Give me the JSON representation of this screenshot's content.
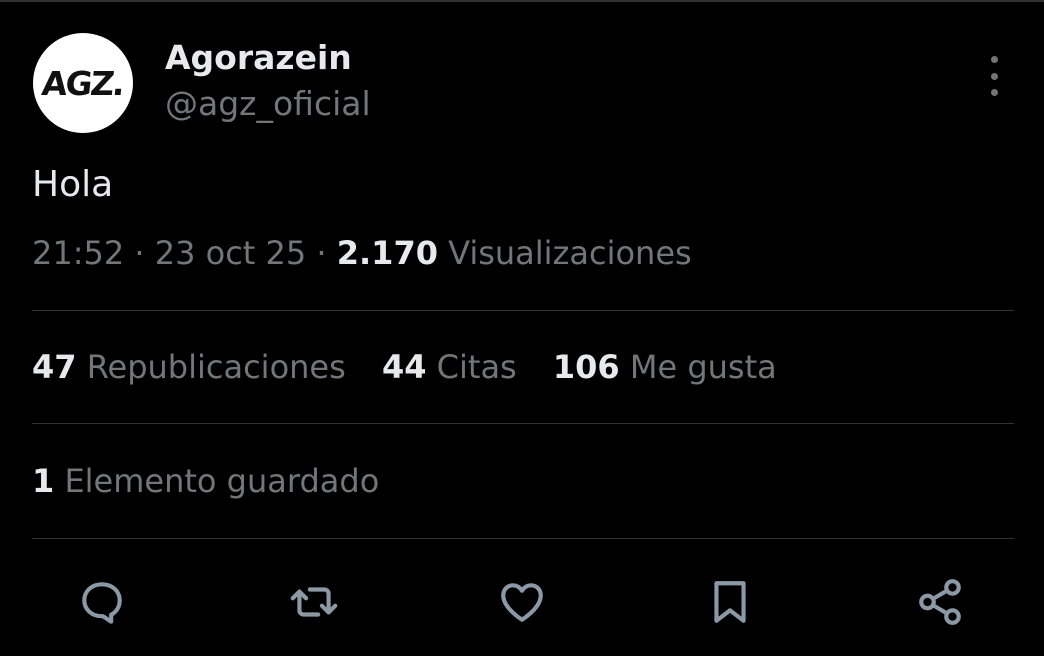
{
  "colors": {
    "background": "#000000",
    "primary_text": "#e7e9ea",
    "secondary_text": "#71767b",
    "divider": "#2f3336",
    "avatar_bg": "#ffffff"
  },
  "author": {
    "avatar_text": "AGZ.",
    "display_name": "Agorazein",
    "handle": "@agz_oficial"
  },
  "tweet": {
    "text": "Hola",
    "time": "21:52",
    "date": "23 oct 25",
    "views_count": "2.170",
    "views_label": "Visualizaciones",
    "separator": "·"
  },
  "stats": {
    "reposts_count": "47",
    "reposts_label": "Republicaciones",
    "quotes_count": "44",
    "quotes_label": "Citas",
    "likes_count": "106",
    "likes_label": "Me gusta"
  },
  "bookmarks": {
    "count": "1",
    "label": "Elemento guardado"
  },
  "actions": [
    {
      "name": "reply",
      "icon": "reply-icon"
    },
    {
      "name": "repost",
      "icon": "repost-icon"
    },
    {
      "name": "like",
      "icon": "heart-icon"
    },
    {
      "name": "bookmark",
      "icon": "bookmark-icon"
    },
    {
      "name": "share",
      "icon": "share-icon"
    }
  ]
}
